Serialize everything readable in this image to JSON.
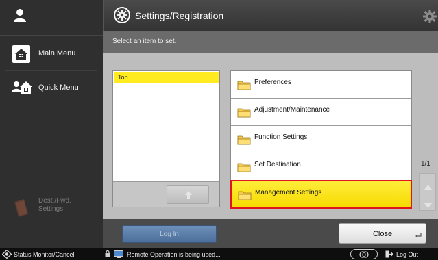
{
  "sidebar": {
    "main_menu": "Main Menu",
    "quick_menu": "Quick Menu",
    "dest_fwd_line1": "Dest./Fwd.",
    "dest_fwd_line2": "Settings"
  },
  "header": {
    "title": "Settings/Registration"
  },
  "subheader": {
    "hint": "Select an item to set."
  },
  "tree": {
    "current": "Top"
  },
  "items": [
    {
      "label": "Preferences",
      "selected": false
    },
    {
      "label": "Adjustment/Maintenance",
      "selected": false
    },
    {
      "label": "Function Settings",
      "selected": false
    },
    {
      "label": "Set Destination",
      "selected": false
    },
    {
      "label": "Management Settings",
      "selected": true
    }
  ],
  "pager": {
    "page": "1/1"
  },
  "footer": {
    "login_label": "Log In",
    "close_label": "Close"
  },
  "statusbar": {
    "status_monitor": "Status Monitor/Cancel",
    "remote_message": "Remote Operation is being used...",
    "logout_label": "Log Out"
  },
  "colors": {
    "selected_fill": "#ffeb1f",
    "selected_border": "#e0141c",
    "login_button": "#5a7ea9"
  }
}
